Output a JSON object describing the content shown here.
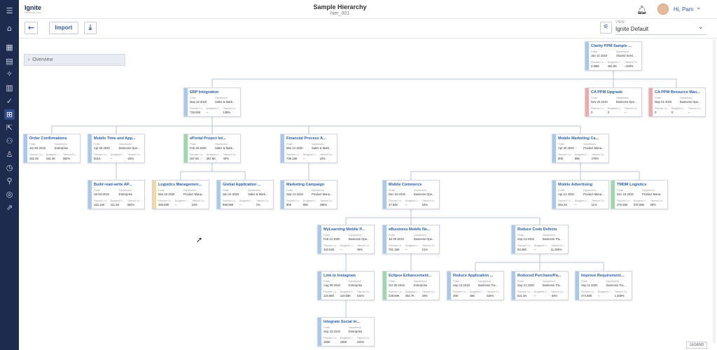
{
  "header": {
    "logo": "Ignite",
    "logo_sub": "TECHNOLOGY",
    "title": "Sample Hierarchy",
    "subtitle": "hier_001",
    "greeting": "Hi, Pam"
  },
  "toolbar": {
    "import_label": "Import",
    "view_label": "VIEW",
    "view_value": "Ignite Default"
  },
  "overview_label": "Overview",
  "legend_label": "LEGEND",
  "colors": {
    "sidebar": "#1d2b4f",
    "blue": "#a9c8f0",
    "red": "#f0a8ab",
    "green": "#9bd9a7",
    "yellow": "#f3d9a0"
  },
  "cards": [
    {
      "id": "c0",
      "title": "Clarity PPM Sample ...",
      "color": "blue",
      "l1": [
        "Finish",
        "Department"
      ],
      "v1": [
        "Jan 14 2020",
        "Shared Servi..."
      ],
      "l2": [
        "Planned Co...",
        "Budgeted C...",
        "Planned Co..."
      ],
      "v2": [
        "2.86M",
        "464.5K",
        "~100%"
      ]
    },
    {
      "id": "c1",
      "title": "ERP Integration",
      "color": "blue",
      "l1": [
        "Finish",
        "Department"
      ],
      "v1": [
        "May 22 2020",
        "Sales & Mark..."
      ],
      "l2": [
        "Planned Co...",
        "Budgeted C...",
        "Planned Co..."
      ],
      "v2": [
        "726.92K",
        "--",
        "138%"
      ]
    },
    {
      "id": "c2",
      "title": "CA PPM Upgrade",
      "color": "red",
      "l1": [
        "Finish",
        "Department"
      ],
      "v1": [
        "Nov 20 2019",
        "Business Ope..."
      ],
      "l2": [
        "Planned Co...",
        "Budgeted C...",
        "Planned Co..."
      ],
      "v2": [
        "0",
        "0",
        "--"
      ]
    },
    {
      "id": "c3",
      "title": "CA PPM Resource Man...",
      "color": "red",
      "l1": [
        "Finish",
        "Department"
      ],
      "v1": [
        "May 01 2020",
        "Business Ope..."
      ],
      "l2": [
        "Planned Co...",
        "Budgeted C...",
        "Planned Co..."
      ],
      "v2": [
        "0",
        "0",
        "--"
      ]
    },
    {
      "id": "c4",
      "title": "Order Confirmations",
      "color": "blue",
      "l1": [
        "Finish",
        "Department"
      ],
      "v1": [
        "Jun 05 2019",
        "Enterprise"
      ],
      "l2": [
        "Planned Co...",
        "Budgeted C...",
        "Planned Co..."
      ],
      "v2": [
        "162.4K",
        "162.4K",
        "550%"
      ]
    },
    {
      "id": "c5",
      "title": "Mobile Time and App...",
      "color": "blue",
      "l1": [
        "Finish",
        "Department"
      ],
      "v1": [
        "Apr 28 2020",
        "Business Ope..."
      ],
      "l2": [
        "Planned Co...",
        "Budgeted C...",
        "Planned Co..."
      ],
      "v2": [
        "501K",
        "--",
        "-26%"
      ]
    },
    {
      "id": "c6",
      "title": "ePortal Project Int...",
      "color": "green",
      "l1": [
        "Finish",
        "Department"
      ],
      "v1": [
        "Feb 26 2020",
        "Sales & Mark..."
      ],
      "l2": [
        "Planned Co...",
        "Budgeted C...",
        "Planned Co..."
      ],
      "v2": [
        "357.5K",
        "357.5K",
        "40%"
      ]
    },
    {
      "id": "c7",
      "title": "Financial Process A...",
      "color": "blue",
      "l1": [
        "Finish",
        "Department"
      ],
      "v1": [
        "Mar 24 2020",
        "Sales & Mark..."
      ],
      "l2": [
        "Planned Co...",
        "Budgeted C...",
        "Planned Co..."
      ],
      "v2": [
        "739.16K",
        "--",
        "10%"
      ]
    },
    {
      "id": "c8",
      "title": "Mobile Marketing Ca...",
      "color": "blue",
      "l1": [
        "Finish",
        "Department"
      ],
      "v1": [
        "Apr 30 2020",
        "Product Mana..."
      ],
      "l2": [
        "Planned Co...",
        "Budgeted C...",
        "Planned Co..."
      ],
      "v2": [
        "80K",
        "80K",
        "276%"
      ]
    },
    {
      "id": "c9",
      "title": "Build read-write AP...",
      "color": "blue",
      "l1": [
        "Finish",
        "Department"
      ],
      "v1": [
        "Jul 03 2019",
        "Enterprise"
      ],
      "l2": [
        "Planned Co...",
        "Budgeted C...",
        "Planned Co..."
      ],
      "v2": [
        "154.16K",
        "111.5K",
        "652%"
      ]
    },
    {
      "id": "c10",
      "title": "Logistics Managemen...",
      "color": "yellow",
      "l1": [
        "Finish",
        "Department"
      ],
      "v1": [
        "Mar 20 2020",
        "Product Mana..."
      ],
      "l2": [
        "Planned Co...",
        "Budgeted C...",
        "Planned Co..."
      ],
      "v2": [
        "459.68K",
        "--",
        "54%"
      ]
    },
    {
      "id": "c11",
      "title": "Global Application ...",
      "color": "blue",
      "l1": [
        "Finish",
        "Department"
      ],
      "v1": [
        "Jan 24 2020",
        "Sales & Mark..."
      ],
      "l2": [
        "Planned Co...",
        "Budgeted C...",
        "Planned Co..."
      ],
      "v2": [
        "595.99K",
        "--",
        "2%"
      ]
    },
    {
      "id": "c12",
      "title": "Marketing Campaign",
      "color": "blue",
      "l1": [
        "Finish",
        "Department"
      ],
      "v1": [
        "Sep 13 2019",
        "Product Mana..."
      ],
      "l2": [
        "Planned Co...",
        "Budgeted C...",
        "Planned Co..."
      ],
      "v2": [
        "80K",
        "80K",
        "265%"
      ]
    },
    {
      "id": "c13",
      "title": "Mobile Commerce",
      "color": "blue",
      "l1": [
        "Finish",
        "Department"
      ],
      "v1": [
        "Dec 02 2019",
        "Business Ope..."
      ],
      "l2": [
        "Planned Co...",
        "Budgeted C...",
        "Planned Co..."
      ],
      "v2": [
        "27.82K",
        "--",
        "53%"
      ]
    },
    {
      "id": "c14",
      "title": "Mobile Advertising",
      "color": "blue",
      "l1": [
        "Finish",
        "Department"
      ],
      "v1": [
        "Apr 14 2020",
        "Product Mana..."
      ],
      "l2": [
        "Planned Co...",
        "Budgeted C...",
        "Planned Co..."
      ],
      "v2": [
        "264.4K",
        "--",
        "11%"
      ]
    },
    {
      "id": "c15",
      "title": "TMDM Logistics",
      "color": "green",
      "l1": [
        "Finish",
        "Department"
      ],
      "v1": [
        "Dec 18 2019",
        "Product Mana..."
      ],
      "l2": [
        "Planned Co...",
        "Budgeted C...",
        "Planned Co..."
      ],
      "v2": [
        "375.59K",
        "375.59K",
        "90%"
      ]
    },
    {
      "id": "c16",
      "title": "MyLearning Mobile P...",
      "color": "blue",
      "l1": [
        "Finish",
        "Department"
      ],
      "v1": [
        "Feb 24 2020",
        "Business Ope..."
      ],
      "l2": [
        "Planned Co...",
        "Budgeted C...",
        "Planned Co..."
      ],
      "v2": [
        "343.52K",
        "--",
        "45%"
      ]
    },
    {
      "id": "c17",
      "title": "eBusiness Mobile Ne...",
      "color": "blue",
      "l1": [
        "Finish",
        "Department"
      ],
      "v1": [
        "Jul 09 2019",
        "Business Ope..."
      ],
      "l2": [
        "Planned Co...",
        "Budgeted C...",
        "Planned Co..."
      ],
      "v2": [
        "751.18K",
        "--",
        "21%"
      ]
    },
    {
      "id": "c18",
      "title": "Reduce Code Defects",
      "color": "blue",
      "l1": [
        "Finish",
        "Department"
      ],
      "v1": [
        "Sep 12 2019",
        "Business Tra..."
      ],
      "l2": [
        "Planned Co...",
        "Budgeted C...",
        "Planned Co..."
      ],
      "v2": [
        "63.48K",
        "--",
        "11,306%"
      ]
    },
    {
      "id": "c19",
      "title": "Link to Instagram",
      "color": "blue",
      "l1": [
        "Finish",
        "Department"
      ],
      "v1": [
        "Aug 09 2019",
        "Enterprise"
      ],
      "l2": [
        "Planned Co...",
        "Budgeted C...",
        "Planned Co..."
      ],
      "v2": [
        "119.65K",
        "119.65K",
        "244%"
      ]
    },
    {
      "id": "c20",
      "title": "Eclipse Enhancement...",
      "color": "green",
      "l1": [
        "Finish",
        "Department"
      ],
      "v1": [
        "Oct 05 2019",
        "Enterprise"
      ],
      "l2": [
        "Planned Co...",
        "Budgeted C...",
        "Planned Co..."
      ],
      "v2": [
        "239.69K",
        "282.7K",
        "26%"
      ]
    },
    {
      "id": "c21",
      "title": "Reduce Application ...",
      "color": "blue",
      "l1": [
        "Finish",
        "Department"
      ],
      "v1": [
        "Sep 12 2019",
        "Business Tra..."
      ],
      "l2": [
        "Planned Co...",
        "Budgeted C...",
        "Planned Co..."
      ],
      "v2": [
        "45K",
        "45K",
        "316%"
      ]
    },
    {
      "id": "c22",
      "title": "Reduced Purchase/Pa...",
      "color": "blue",
      "l1": [
        "Finish",
        "Department"
      ],
      "v1": [
        "Sep 21 2020",
        "Business Tra..."
      ],
      "l2": [
        "Planned Co...",
        "Budgeted C...",
        "Planned Co..."
      ],
      "v2": [
        "521.3K",
        "--",
        "-34%"
      ]
    },
    {
      "id": "c23",
      "title": "Improve Requirement...",
      "color": "blue",
      "l1": [
        "Finish",
        "Department"
      ],
      "v1": [
        "Sep 11 2020",
        "Business Tra..."
      ],
      "l2": [
        "Planned Co...",
        "Budgeted C...",
        "Planned Co..."
      ],
      "v2": [
        "474.65K",
        "--",
        "1,259%"
      ]
    },
    {
      "id": "c24",
      "title": "Integrate Social in...",
      "color": "blue",
      "l1": [
        "Finish",
        "Department"
      ],
      "v1": [
        "Sep 23 2019",
        "Enterprise"
      ],
      "l2": [
        "Planned Co...",
        "Budgeted C...",
        "Planned Co..."
      ],
      "v2": [
        "165K",
        "165K",
        "244%"
      ]
    }
  ]
}
